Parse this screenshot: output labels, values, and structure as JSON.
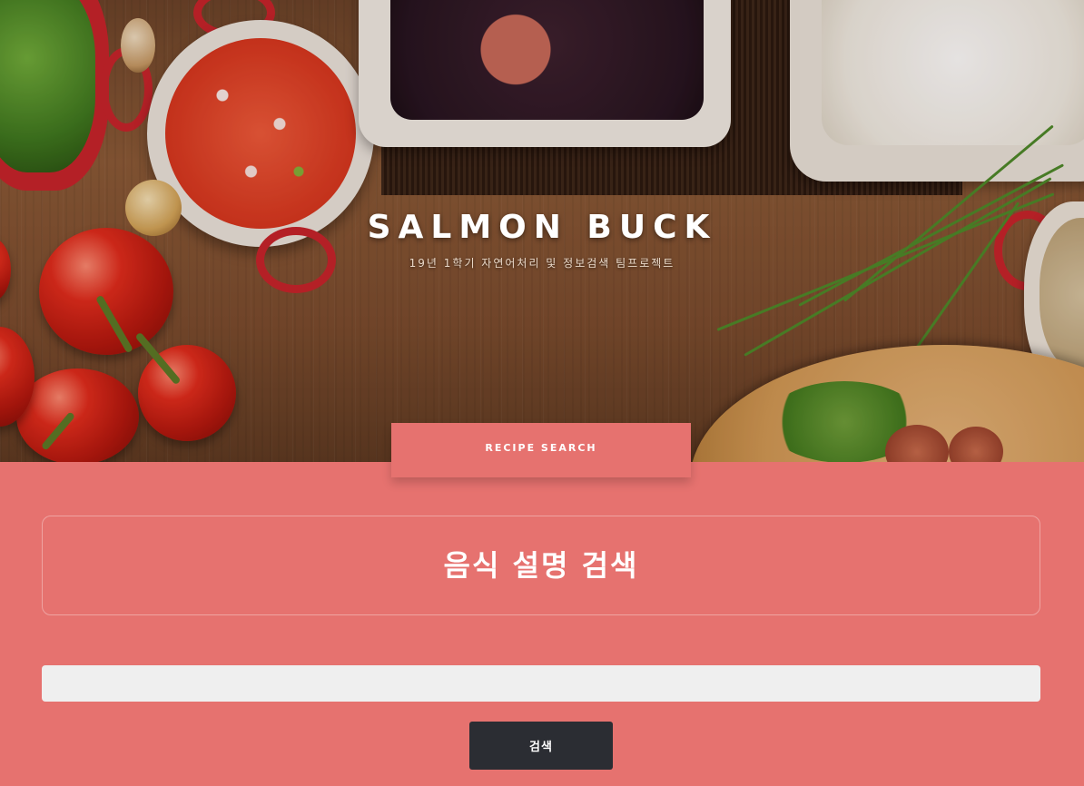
{
  "hero": {
    "title": "SALMON BUCK",
    "subtitle": "19년 1학기 자연어처리 및 정보검색 팀프로젝트"
  },
  "tab": {
    "label": "RECIPE SEARCH"
  },
  "search": {
    "heading": "음식 설명 검색",
    "input_value": "",
    "button_label": "검색"
  },
  "colors": {
    "accent": "#e6726f",
    "button": "#2b2d33",
    "input_bg": "#efefef"
  }
}
